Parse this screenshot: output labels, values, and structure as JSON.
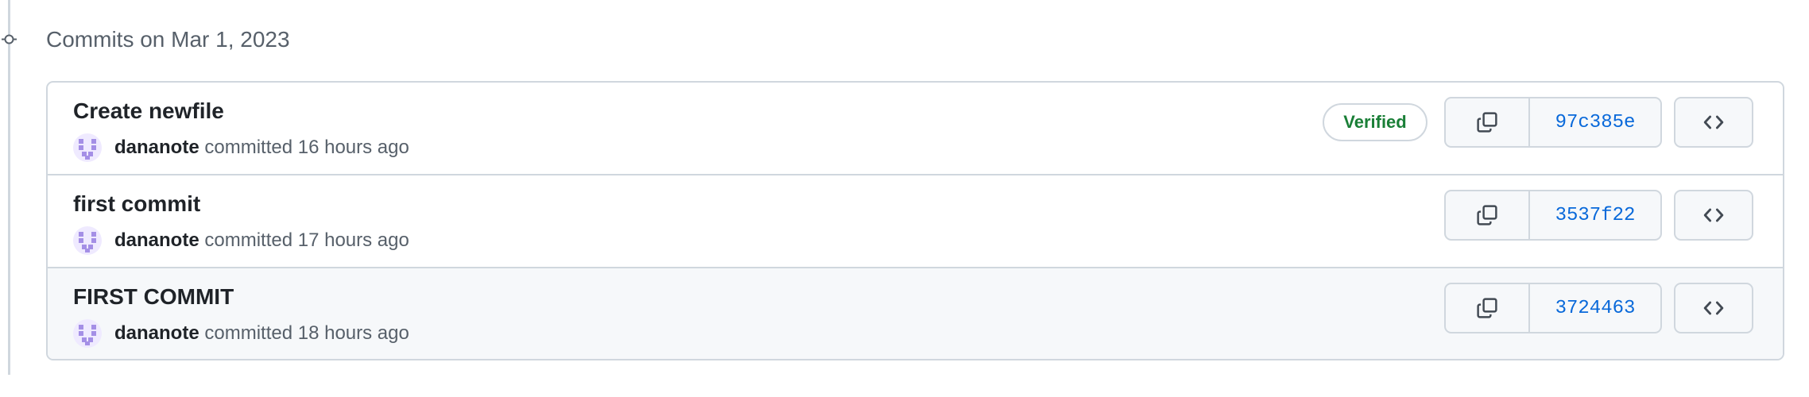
{
  "group": {
    "heading": "Commits on Mar 1, 2023"
  },
  "commits": [
    {
      "title": "Create newfile",
      "author": "dananote",
      "action": "committed",
      "time": "16 hours ago",
      "verified_label": "Verified",
      "sha": "97c385e"
    },
    {
      "title": "first commit",
      "author": "dananote",
      "action": "committed",
      "time": "17 hours ago",
      "sha": "3537f22"
    },
    {
      "title": "FIRST COMMIT",
      "author": "dananote",
      "action": "committed",
      "time": "18 hours ago",
      "sha": "3724463"
    }
  ],
  "icons": {
    "timeline": "git-commit-icon",
    "copy": "copy-icon",
    "browse": "code-icon"
  },
  "colors": {
    "link": "#0969da",
    "verified": "#1a7f37",
    "border": "#d0d7de",
    "muted": "#57606a"
  }
}
